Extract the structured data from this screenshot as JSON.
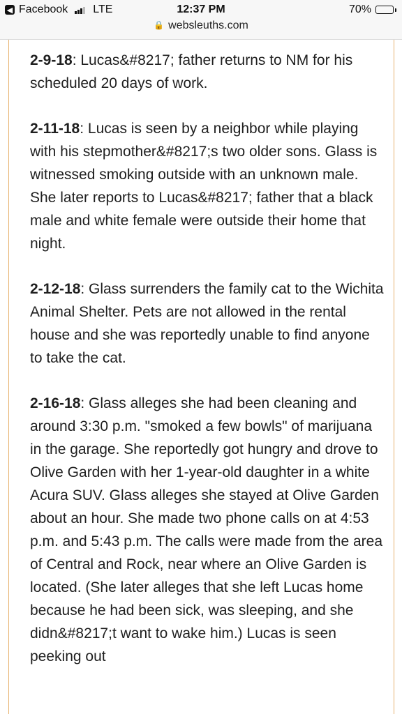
{
  "status_bar": {
    "back_app": "Facebook",
    "network": "LTE",
    "time": "12:37 PM",
    "battery": "70%",
    "battery_level": 0.7,
    "url": "websleuths.com"
  },
  "entries": [
    {
      "date": "2-9-18",
      "text": ": Lucas&#8217; father returns to NM for his scheduled 20 days of work."
    },
    {
      "date": "2-11-18",
      "text": ": Lucas is seen by a neighbor while playing with his stepmother&#8217;s two older sons. Glass is witnessed smoking outside with an unknown male. She later reports to Lucas&#8217; father that a black male and white female were outside their home that night."
    },
    {
      "date": "2-12-18",
      "text": ": Glass surrenders the family cat to the Wichita Animal Shelter. Pets are not allowed in the rental house and she was reportedly unable to find anyone to take the cat."
    },
    {
      "date": "2-16-18",
      "text": ": Glass alleges she had been cleaning and around 3:30 p.m. \"smoked a few bowls\" of marijuana in the garage. She reportedly got hungry and drove to Olive Garden with her 1-year-old daughter in a white Acura SUV. Glass alleges she stayed at Olive Garden about an hour. She made two phone calls on at 4:53 p.m. and 5:43 p.m. The calls were made from the area of Central and Rock, near where an Olive Garden is located. (She later alleges that she left Lucas home because he had been sick, was sleeping, and she didn&#8217;t want to wake him.) Lucas is seen peeking out"
    }
  ]
}
